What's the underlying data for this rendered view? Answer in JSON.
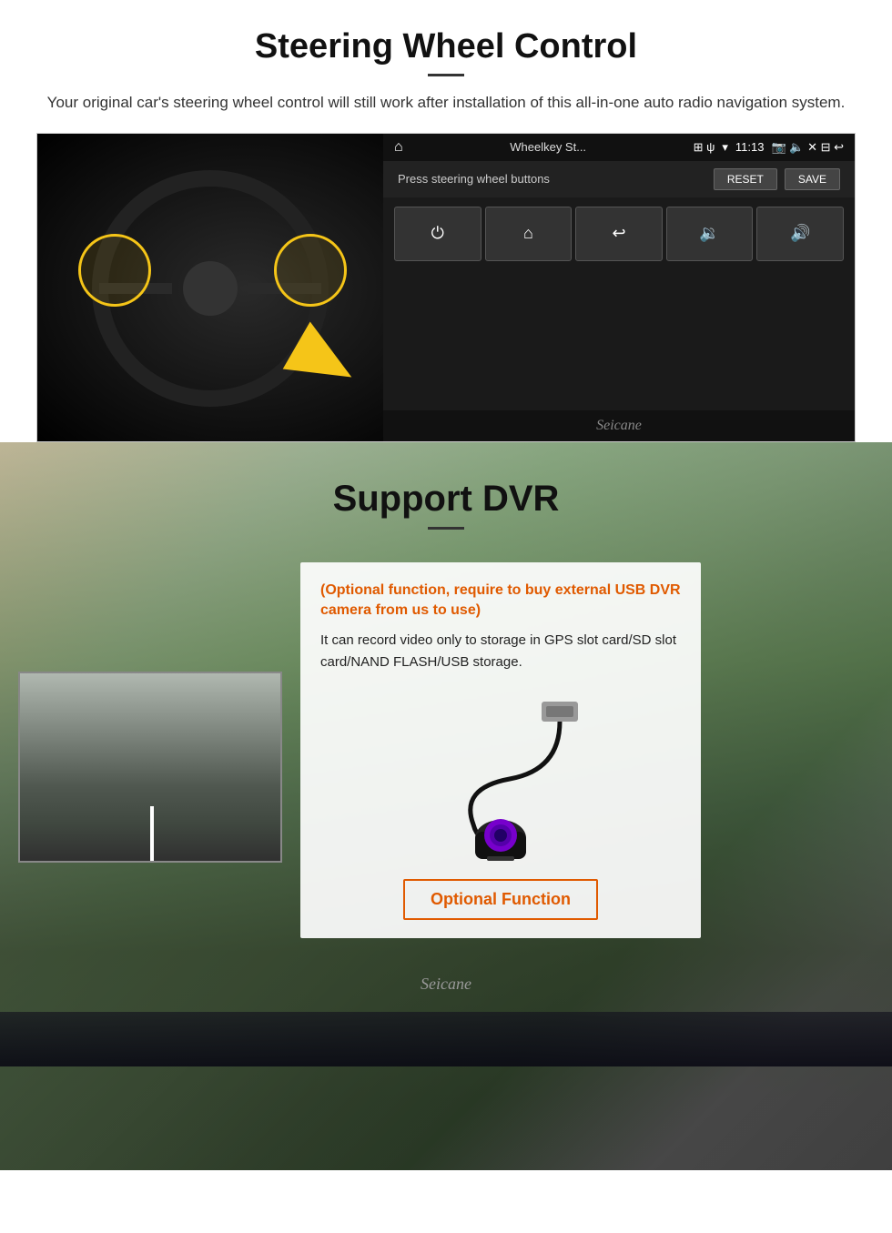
{
  "steering_section": {
    "title": "Steering Wheel Control",
    "subtitle": "Your original car's steering wheel control will still work after installation of this all-in-one auto radio navigation system.",
    "ui_panel": {
      "topbar_icon": "⌂",
      "topbar_title": "Wheelkey St...",
      "topbar_icons_right": "⊞ ψ",
      "signal_icon": "▾",
      "time": "11:13",
      "extra_icons": "📷 🔈 ✕ ⊟ ↩",
      "instruction": "Press steering wheel buttons",
      "reset_label": "RESET",
      "save_label": "SAVE"
    },
    "control_buttons": [
      {
        "icon": "⏻",
        "label": "power"
      },
      {
        "icon": "⌂",
        "label": "home"
      },
      {
        "icon": "↩",
        "label": "back"
      },
      {
        "icon": "🔉",
        "label": "vol-down"
      },
      {
        "icon": "🔊",
        "label": "vol-up"
      }
    ],
    "watermark": "Seicane"
  },
  "dvr_section": {
    "title": "Support DVR",
    "optional_note": "(Optional function, require to buy external USB DVR camera from us to use)",
    "description": "It can record video only to storage in GPS slot card/SD slot card/NAND FLASH/USB storage.",
    "optional_function_label": "Optional Function",
    "watermark": "Seicane"
  }
}
